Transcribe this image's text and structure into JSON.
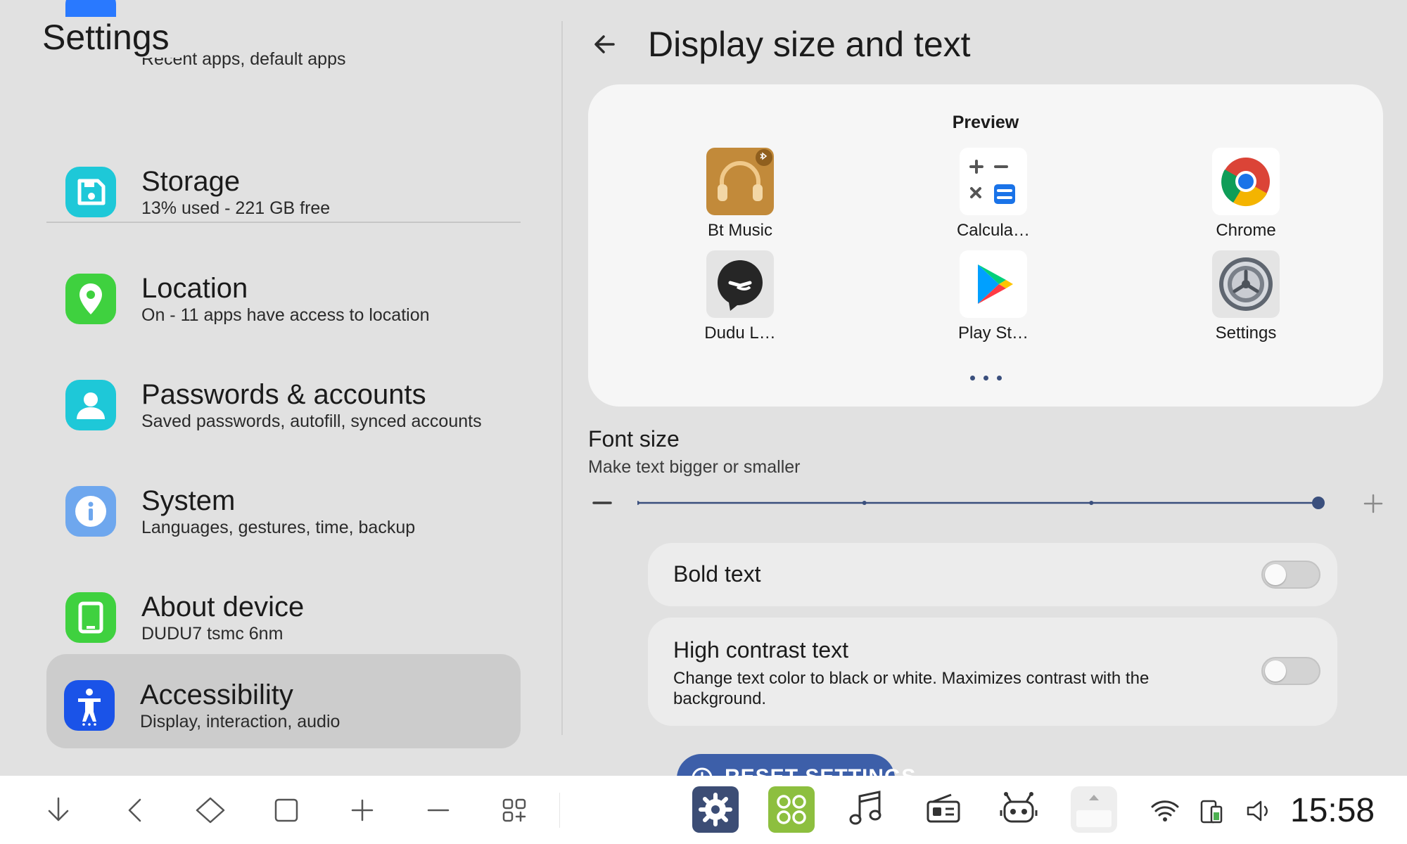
{
  "settings_list": {
    "title": "Settings",
    "items": [
      {
        "title": "",
        "subtitle": "Recent apps, default apps",
        "icon": "apps-icon",
        "color": "#2979ff"
      },
      {
        "title": "Storage",
        "subtitle": "13% used - 221 GB free",
        "icon": "storage-icon",
        "color": "#1ec8d8"
      },
      {
        "title": "Location",
        "subtitle": "On - 11 apps have access to location",
        "icon": "location-pin-icon",
        "color": "#3fd13f"
      },
      {
        "title": "Passwords & accounts",
        "subtitle": "Saved passwords, autofill, synced accounts",
        "icon": "account-icon",
        "color": "#1ec8d8"
      },
      {
        "title": "System",
        "subtitle": "Languages, gestures, time, backup",
        "icon": "info-icon",
        "color": "#6ea7ee"
      },
      {
        "title": "About device",
        "subtitle": "DUDU7 tsmc 6nm",
        "icon": "device-icon",
        "color": "#3fd13f"
      },
      {
        "title": "Accessibility",
        "subtitle": "Display, interaction, audio",
        "icon": "accessibility-icon",
        "color": "#1a53e8",
        "selected": true
      }
    ]
  },
  "detail": {
    "title": "Display size and text",
    "preview": {
      "label": "Preview",
      "apps": [
        {
          "label": "Bt Music",
          "icon": "headphones-icon"
        },
        {
          "label": "Calcula…",
          "icon": "calculator-icon"
        },
        {
          "label": "Chrome",
          "icon": "chrome-icon"
        },
        {
          "label": "Dudu L…",
          "icon": "dudu-launcher-icon"
        },
        {
          "label": "Play St…",
          "icon": "play-store-icon"
        },
        {
          "label": "Settings",
          "icon": "settings-gear-icon"
        }
      ],
      "page_count": 3
    },
    "font_size": {
      "title": "Font size",
      "subtitle": "Make text bigger or smaller",
      "steps": 4,
      "selected_step": 4
    },
    "bold_text": {
      "title": "Bold text",
      "enabled": false
    },
    "high_contrast": {
      "title": "High contrast text",
      "subtitle": "Change text color to black or white. Maximizes contrast with the background.",
      "enabled": false
    },
    "reset_button": "RESET SETTINGS"
  },
  "bottom_bar": {
    "nav_icons": [
      "arrow-down-icon",
      "back-chevron-icon",
      "home-diamond-icon",
      "recents-square-icon",
      "volume-plus-icon",
      "volume-minus-icon",
      "app-grid-icon"
    ],
    "dock_apps": [
      "settings-app-icon",
      "launcher-app-icon",
      "music-note-icon",
      "radio-icon",
      "robot-icon",
      "expand-tray-icon"
    ],
    "status_icons": [
      "wifi-icon",
      "battery-phone-icon",
      "speaker-icon"
    ],
    "clock": "15:58"
  },
  "colors": {
    "accent": "#3d5fa9",
    "slider_track": "#3a4f7d",
    "background": "#e1e1e1",
    "card": "#f6f6f6"
  }
}
